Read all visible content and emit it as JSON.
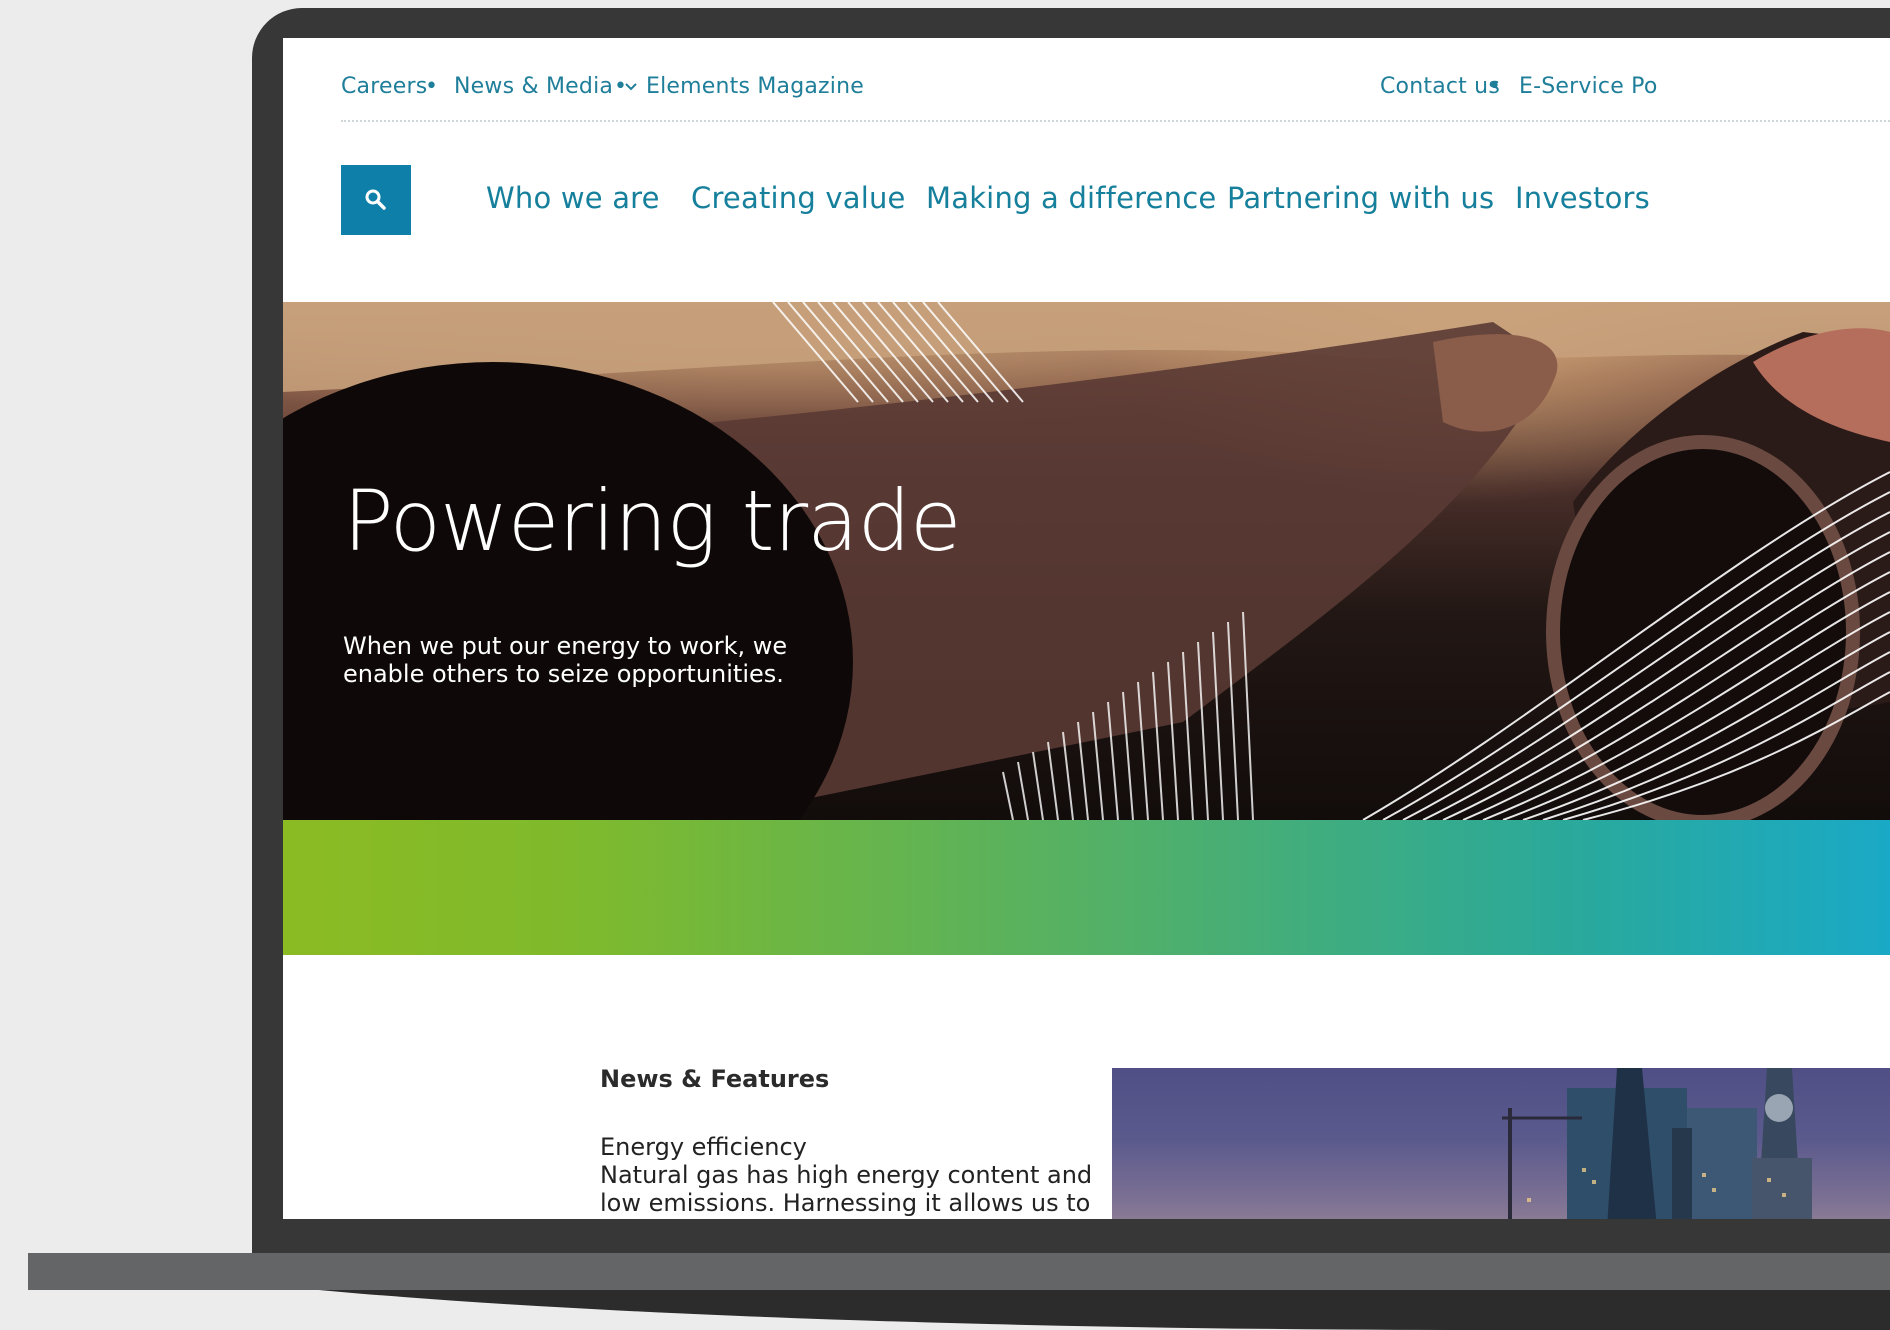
{
  "utility_nav": {
    "left": [
      {
        "label": "Careers"
      },
      {
        "label": "News & Media"
      },
      {
        "label": "Elements Magazine"
      }
    ],
    "right": [
      {
        "label": "Contact us"
      },
      {
        "label": "E-Service Po"
      }
    ]
  },
  "main_nav": {
    "items": [
      {
        "label": "Who we are"
      },
      {
        "label": "Creating value"
      },
      {
        "label": "Making a difference"
      },
      {
        "label": "Partnering with us"
      },
      {
        "label": "Investors"
      }
    ]
  },
  "hero": {
    "title": "Powering trade",
    "subtitle": "When we put our energy to work, we enable others to seize opportunities."
  },
  "news": {
    "heading": "News & Features",
    "item_title": "Energy efficiency",
    "item_text": "Natural gas has high energy content and low emissions. Harnessing it allows us to save"
  },
  "colors": {
    "link": "#1f7e9a",
    "search_bg": "#0d7fa8",
    "band_start": "#8bbb23",
    "band_end": "#1aa9c6"
  },
  "icons": {
    "search": "search-icon",
    "dropdown": "chevron-down-icon"
  }
}
